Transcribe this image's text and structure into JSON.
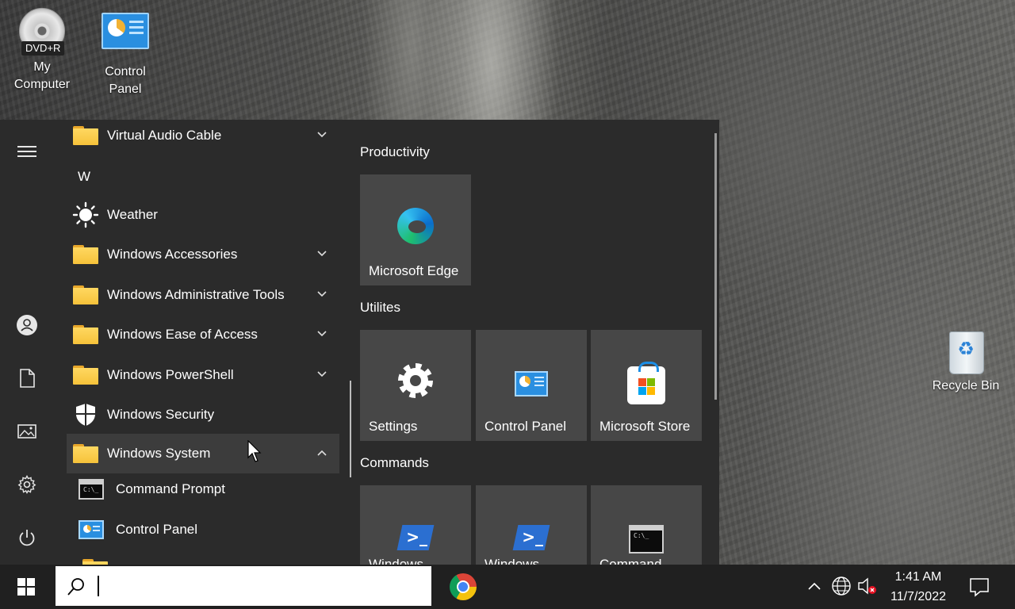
{
  "desktop": {
    "icons": {
      "my_computer": {
        "label": "My\nComputer",
        "badge": "DVD+R"
      },
      "control_panel": {
        "label": "Control\nPanel"
      },
      "recycle_bin": {
        "label": "Recycle Bin"
      }
    }
  },
  "start_menu": {
    "app_list": {
      "items": [
        {
          "label": "Virtual Audio Cable",
          "kind": "folder",
          "expandable": true
        },
        {
          "letter": "W"
        },
        {
          "label": "Weather",
          "kind": "app"
        },
        {
          "label": "Windows Accessories",
          "kind": "folder",
          "expandable": true
        },
        {
          "label": "Windows Administrative Tools",
          "kind": "folder",
          "expandable": true
        },
        {
          "label": "Windows Ease of Access",
          "kind": "folder",
          "expandable": true
        },
        {
          "label": "Windows PowerShell",
          "kind": "folder",
          "expandable": true
        },
        {
          "label": "Windows Security",
          "kind": "app"
        },
        {
          "label": "Windows System",
          "kind": "folder",
          "expanded": true
        },
        {
          "label": "Command Prompt",
          "kind": "subapp"
        },
        {
          "label": "Control Panel",
          "kind": "subapp"
        }
      ]
    },
    "tile_groups": [
      {
        "title": "Productivity",
        "tiles": [
          {
            "label": "Microsoft Edge",
            "icon": "edge-icon"
          }
        ]
      },
      {
        "title": "Utilites",
        "tiles": [
          {
            "label": "Settings",
            "icon": "gear-icon"
          },
          {
            "label": "Control Panel",
            "icon": "control-panel-icon"
          },
          {
            "label": "Microsoft Store",
            "icon": "store-icon"
          }
        ]
      },
      {
        "title": "Commands",
        "tiles": [
          {
            "label": "Windows",
            "icon": "powershell-icon"
          },
          {
            "label": "Windows",
            "icon": "powershell-icon"
          },
          {
            "label": "Command",
            "icon": "command-prompt-icon"
          }
        ]
      }
    ]
  },
  "taskbar": {
    "search": {
      "value": "",
      "placeholder": ""
    },
    "pinned": [
      {
        "name": "chrome",
        "icon": "chrome-icon"
      }
    ],
    "clock": {
      "time": "1:41 AM",
      "date": "11/7/2022"
    }
  },
  "colors": {
    "menu_bg": "#2b2b2b",
    "tile_bg": "#474747",
    "taskbar_bg": "#202020",
    "selected_row": "#3c3c3c"
  }
}
